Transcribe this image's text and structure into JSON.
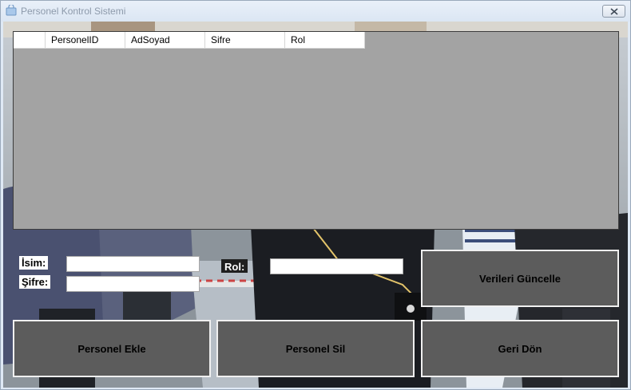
{
  "window": {
    "title": "Personel Kontrol Sistemi",
    "icon": "form-icon",
    "close_icon": "close-icon"
  },
  "grid": {
    "columns": [
      "PersonelID",
      "AdSoyad",
      "Sifre",
      "Rol"
    ],
    "rows": []
  },
  "form": {
    "isim_label": "İsim:",
    "sifre_label": "Şifre:",
    "rol_label": "Rol:",
    "isim_value": "",
    "sifre_value": "",
    "rol_value": ""
  },
  "buttons": {
    "update": "Verileri Güncelle",
    "add": "Personel Ekle",
    "delete": "Personel Sil",
    "back": "Geri Dön"
  },
  "colors": {
    "button_bg": "#5c5c5c",
    "grid_bg": "#a3a3a3",
    "titlebar_text": "#8d9aab"
  }
}
